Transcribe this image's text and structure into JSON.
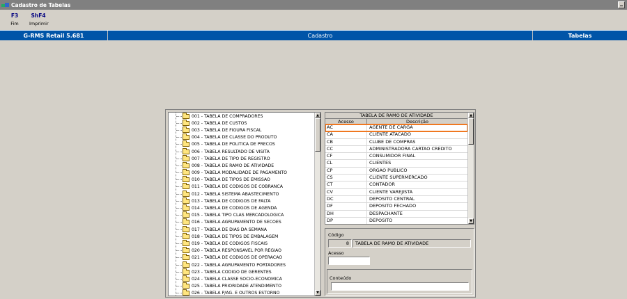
{
  "window": {
    "title": "Cadastro de Tabelas"
  },
  "toolbar": [
    {
      "key": "F3",
      "label": "Fim"
    },
    {
      "key": "ShF4",
      "label": "Imprimir"
    }
  ],
  "header": {
    "left": "G-RMS Retail 5.681",
    "center": "Cadastro",
    "right": "Tabelas"
  },
  "tree": {
    "items": [
      "001 - TABELA DE COMPRADORES",
      "002 - TABELA DE CUSTOS",
      "003 - TABELA DE FIGURA FISCAL",
      "004 - TABELA DE CLASSE DO PRODUTO",
      "005 - TABELA DE POLITICA DE PRECOS",
      "006 - TABELA RESULTADO DE VISITA",
      "007 - TABELA DE TIPO DE REGISTRO",
      "008 - TABELA DE RAMO DE ATIVIDADE",
      "009 - TABELA MODALIDADE DE PAGAMENTO",
      "010 - TABELA DE TIPOS DE EMISSAO",
      "011 - TABELA DE CODIGOS DE COBRANCA",
      "012 - TABELA SISTEMA ABASTECIMENTO",
      "013 - TABELA DE CODIGOS DE FALTA",
      "014 - TABELA DE CODIGOS DE AGENDA",
      "015 - TABELA TIPO CLAS MERCADOLOGICA",
      "016 - TABELA AGRUPAMENTO DE SECOES",
      "017 - TABELA DE DIAS DA SEMANA",
      "018 - TABELA DE TIPOS DE EMBALAGEM",
      "019 - TABELA DE CODIGOS FISCAIS",
      "020 - TABELA RESPONSAVEL POR REGIAO",
      "021 - TABELA DE CODIGOS DE OPERACAO",
      "022 - TABELA AGRUPAMENTO PORTADORES",
      "023 - TABELA CODIGO DE GERENTES",
      "024 - TABELA CLASSE SOCIO-ECONOMICA",
      "025 - TABELA PRIORIDADE ATENDIMENTO",
      "026 - TABELA P/AG. E OUTROS ESTORNO"
    ]
  },
  "grid": {
    "title": "TABELA DE RAMO DE ATIVIDADE",
    "col_acesso": "Acesso",
    "col_descricao": "Descrição",
    "rows": [
      [
        "AC",
        "AGENTE DE CARGA"
      ],
      [
        "CA",
        "CLIENTE ATACADO"
      ],
      [
        "CB",
        "CLUBE DE COMPRAS"
      ],
      [
        "CC",
        "ADMINISTRADORA CARTAO CREDITO"
      ],
      [
        "CF",
        "CONSUMIDOR FINAL"
      ],
      [
        "CL",
        "CLIENTES"
      ],
      [
        "CP",
        "ORGAO PUBLICO"
      ],
      [
        "CS",
        "CLIENTE SUPERMERCADO"
      ],
      [
        "CT",
        "CONTADOR"
      ],
      [
        "CV",
        "CLIENTE VAREJISTA"
      ],
      [
        "DC",
        "DEPOSITO CENTRAL"
      ],
      [
        "DF",
        "DEPOSITO FECHADO"
      ],
      [
        "DH",
        "DESPACHANTE"
      ],
      [
        "DP",
        "DEPOSITO"
      ]
    ]
  },
  "form": {
    "codigo_label": "Código",
    "codigo_value": "8",
    "codigo_desc": "TABELA DE RAMO DE ATIVIDADE",
    "acesso_label": "Acesso",
    "acesso_value": "",
    "conteudo_label": "Conteúdo",
    "conteudo_value": ""
  }
}
